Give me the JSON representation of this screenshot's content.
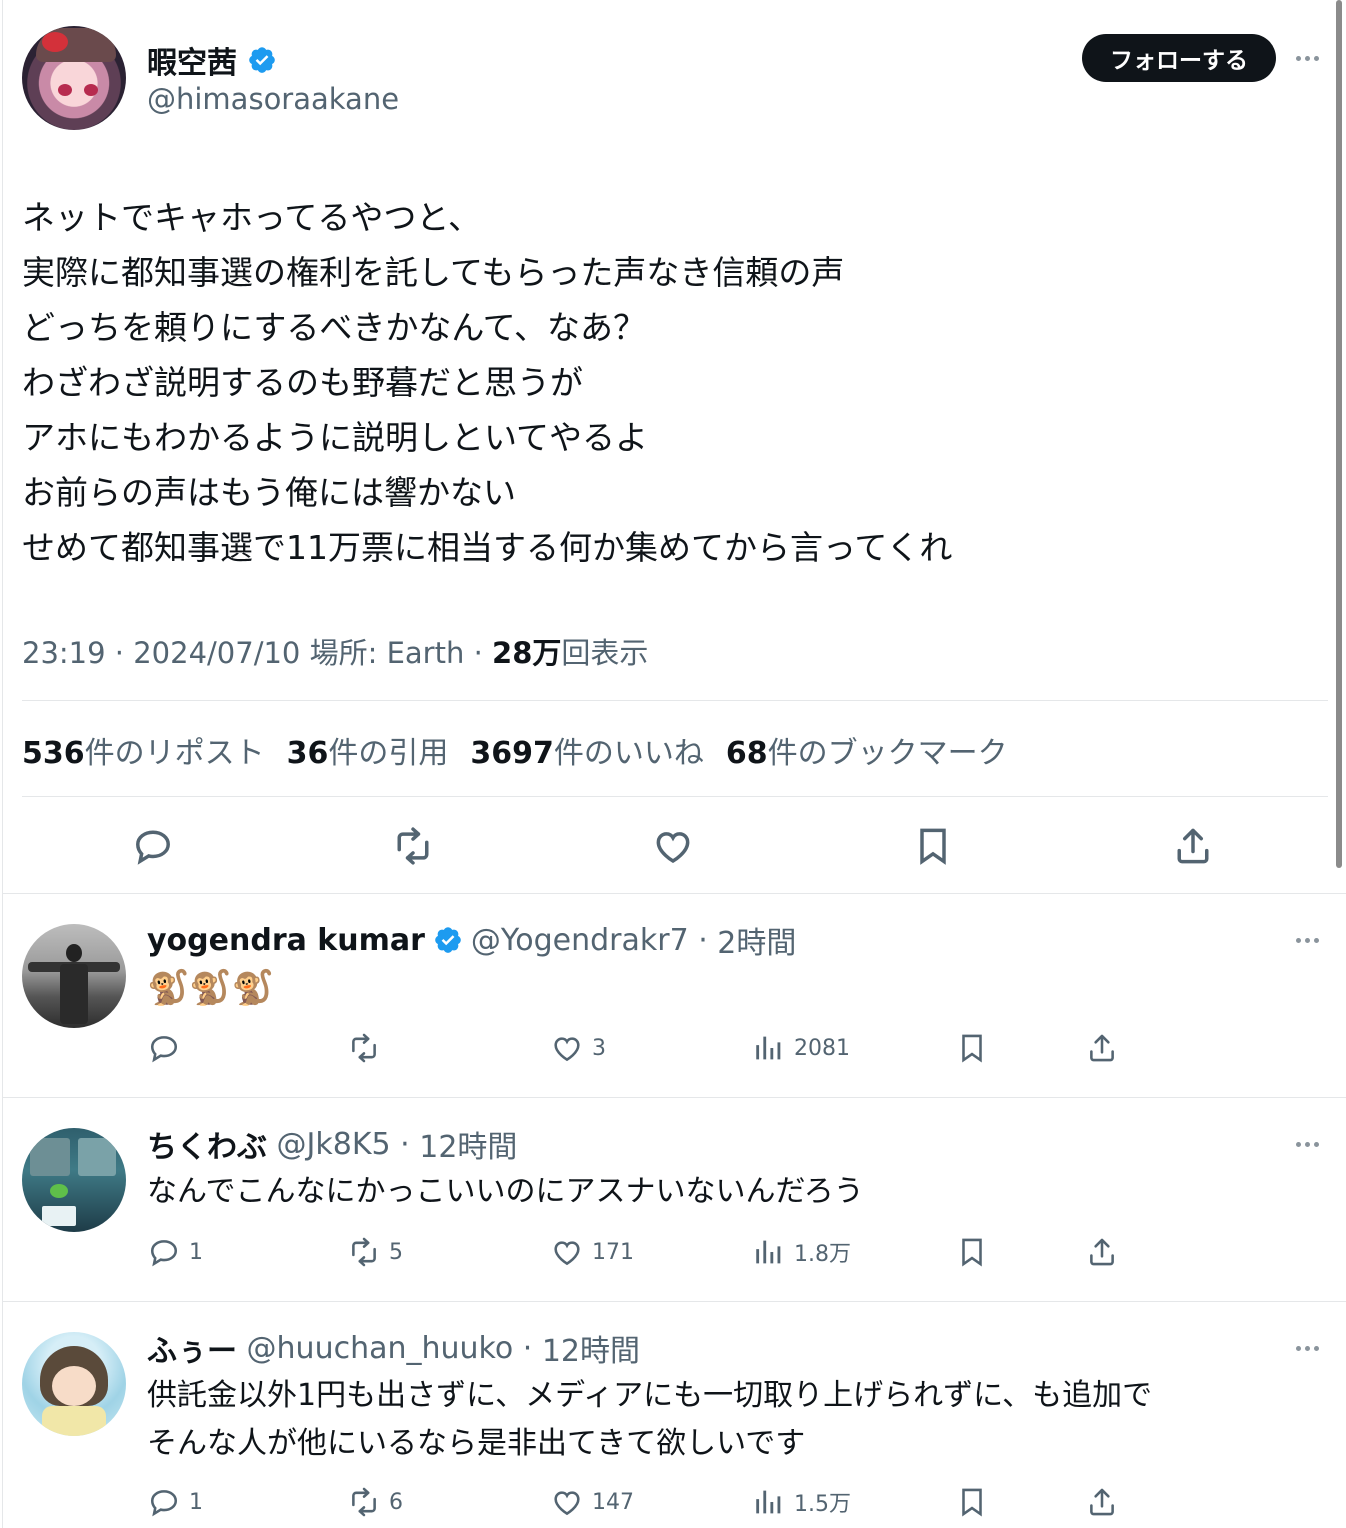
{
  "main_tweet": {
    "name": "暇空茜",
    "handle": "@himasoraakane",
    "follow_label": "フォローする",
    "text": "ネットでキャホってるやつと、\n実際に都知事選の権利を託してもらった声なき信頼の声\nどっちを頼りにするべきかなんて、なあ？\nわざわざ説明するのも野暮だと思うが\nアホにもわかるように説明しといてやるよ\nお前らの声はもう俺には響かない\nせめて都知事選で11万票に相当する何か集めてから言ってくれ",
    "time": "23:19 · 2024/07/10 場所: Earth · ",
    "views_num": "28万",
    "views_label": "回表示",
    "stats": {
      "reposts_num": "536",
      "reposts_label": "件のリポスト",
      "quotes_num": "36",
      "quotes_label": "件の引用",
      "likes_num": "3697",
      "likes_label": "件のいいね",
      "bookmarks_num": "68",
      "bookmarks_label": "件のブックマーク"
    }
  },
  "replies": [
    {
      "name": "yogendra kumar",
      "handle": "@Yogendrakr7",
      "time": "2時間",
      "text": "🐒🐒🐒",
      "replies": "",
      "reposts": "",
      "likes": "3",
      "views": "2081"
    },
    {
      "name": "ちくわぶ",
      "handle": "@Jk8K5",
      "time": "12時間",
      "text": "なんでこんなにかっこいいのにアスナいないんだろう",
      "replies": "1",
      "reposts": "5",
      "likes": "171",
      "views": "1.8万"
    },
    {
      "name": "ふぅー",
      "handle": "@huuchan_huuko",
      "time": "12時間",
      "text": "供託金以外1円も出さずに、メディアにも一切取り上げられずに、も追加で\nそんな人が他にいるなら是非出てきて欲しいです",
      "replies": "1",
      "reposts": "6",
      "likes": "147",
      "views": "1.5万"
    }
  ],
  "colors": {
    "text": "#0f1419",
    "muted": "#536471",
    "verified": "#1d9bf0",
    "border": "#e5e7e9"
  },
  "icons": [
    "verified-icon",
    "more-icon",
    "reply-icon",
    "repost-icon",
    "like-icon",
    "views-icon",
    "bookmark-icon",
    "share-icon"
  ]
}
